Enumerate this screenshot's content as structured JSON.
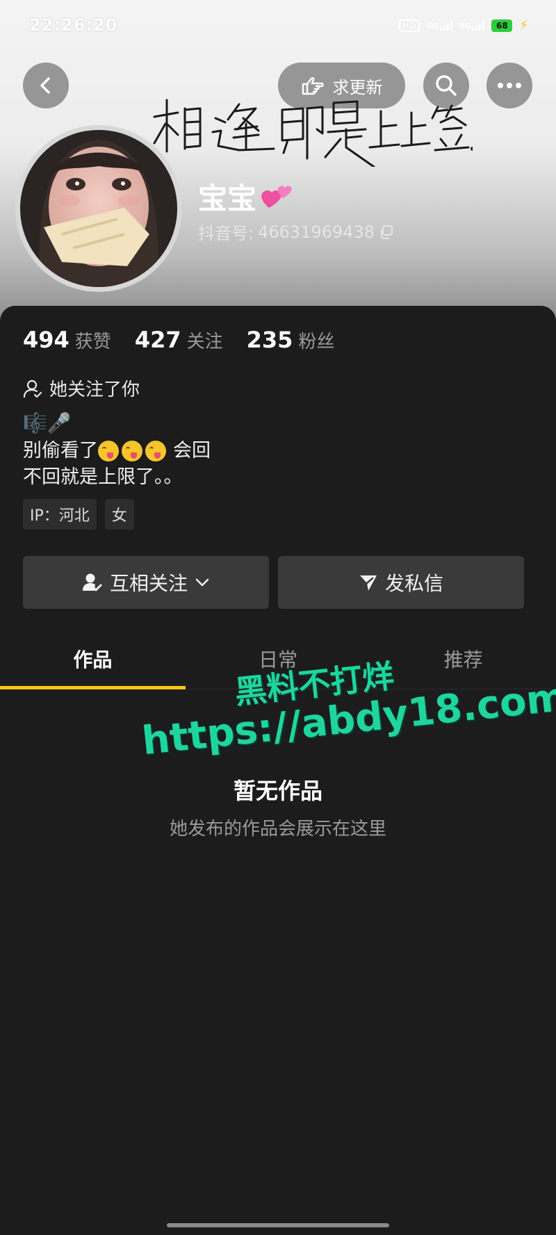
{
  "status_bar": {
    "time": "22:26:20",
    "hd_label": "HD",
    "network_1": "4G",
    "network_2": "5G",
    "battery": "68"
  },
  "header": {
    "request_update_label": "求更新",
    "signature_text": "相逢即是上上签。",
    "nickname": "宝宝",
    "account_prefix": "抖音号:",
    "account_id": "46631969438"
  },
  "stats": [
    {
      "value": "494",
      "label": "获赞"
    },
    {
      "value": "427",
      "label": "关注"
    },
    {
      "value": "235",
      "label": "粉丝"
    }
  ],
  "profile": {
    "follows_you": "她关注了你",
    "bio_emojis": "🎼🎤",
    "bio_line1_text": "别偷看了",
    "bio_line1_suffix": "会回",
    "bio_line2": "不回就是上限了。。",
    "tags": [
      "IP：河北",
      "女"
    ]
  },
  "actions": {
    "mutual_follow": "互相关注",
    "message": "发私信"
  },
  "tabs": [
    {
      "label": "作品",
      "active": true
    },
    {
      "label": "日常",
      "active": false
    },
    {
      "label": "推荐",
      "active": false
    }
  ],
  "watermark": {
    "line1": "黑料不打烊",
    "line2": "https://abdy18.com"
  },
  "empty_state": {
    "title": "暂无作品",
    "description": "她发布的作品会展示在这里"
  },
  "colors": {
    "accent": "#f5c518",
    "background": "#1c1c1c",
    "watermark": "#1fd59e"
  }
}
